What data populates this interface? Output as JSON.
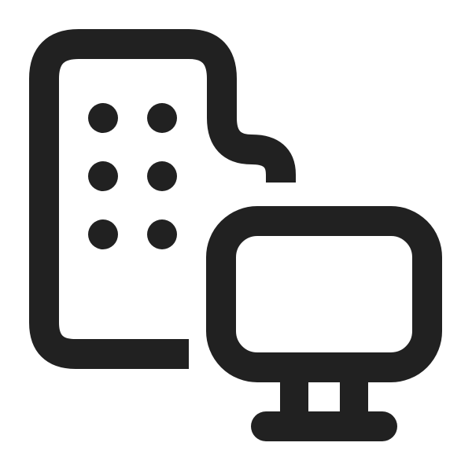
{
  "icon": {
    "name": "building-desktop-icon",
    "color": "#212121",
    "background": "#ffffff"
  }
}
